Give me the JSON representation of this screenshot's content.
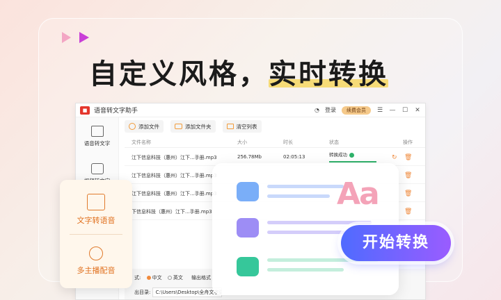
{
  "headline": {
    "part1": "自定义风格，",
    "part2": "实时转换"
  },
  "app": {
    "title": "语音转文字助手",
    "login": "登录",
    "vip": "续费会员",
    "window_controls": [
      "☰",
      "—",
      "☐",
      "✕"
    ]
  },
  "sidebar": {
    "items": [
      {
        "label": "语音转文字"
      },
      {
        "label": "视频转文字"
      }
    ]
  },
  "toolbar": {
    "add_file": "添加文件",
    "add_folder": "添加文件夹",
    "clear_list": "清空列表"
  },
  "table": {
    "headers": [
      "文件名称",
      "大小",
      "时长",
      "状态",
      "操作"
    ],
    "rows": [
      {
        "name": "江下信息科技（惠州）江下...手册.mp3",
        "size": "256.78Mb",
        "duration": "02:05:13",
        "status": "转换成功"
      },
      {
        "name": "江下信息科技（惠州）江下...手册.mp3",
        "size": "",
        "duration": "",
        "status": ""
      },
      {
        "name": "江下信息科技（惠州）江下...手册.mp3",
        "size": "",
        "duration": "",
        "status": ""
      },
      {
        "name": "下信息科技（惠州）江下...手册.mp3",
        "size": "",
        "duration": "",
        "status": ""
      }
    ]
  },
  "bottom": {
    "format_label": "式:",
    "opt_cn": "中文",
    "opt_en": "英文",
    "output_label": "输出格式",
    "dir_label": "出目录:",
    "path": "C:\\Users\\Desktop\\全舟文字语..."
  },
  "float_left": {
    "item1": "文字转语音",
    "item2": "多主播配音"
  },
  "float_right": {
    "aa": "Aa"
  },
  "start_button": "开始转换",
  "colors": {
    "accent": "#f08a3c",
    "brand_red": "#e4362c",
    "success": "#2fb26a",
    "button_start": "#4f6bff",
    "button_end": "#9a5cff"
  }
}
